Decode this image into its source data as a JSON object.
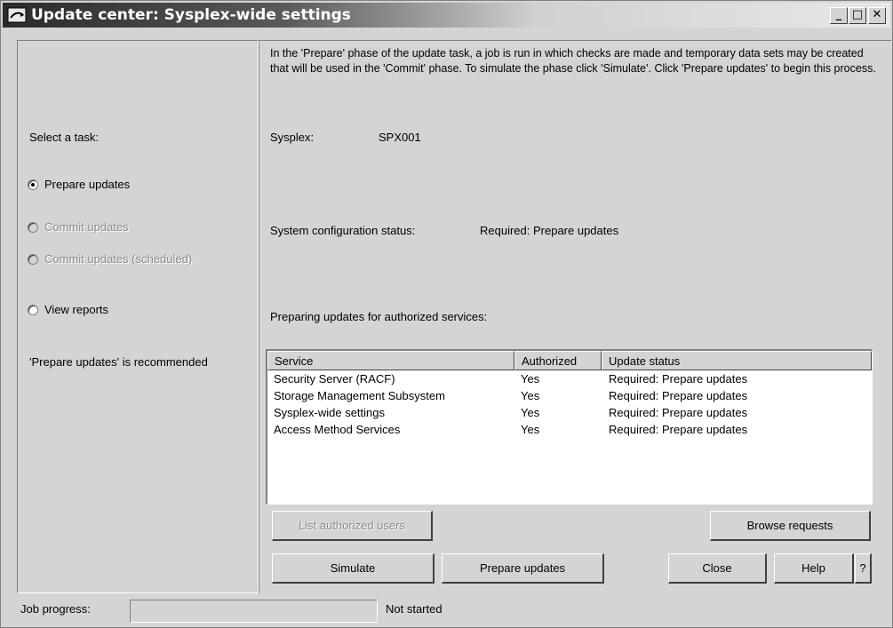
{
  "window": {
    "title": "Update center: Sysplex-wide settings",
    "controls": {
      "minimize": "_",
      "maximize": "□",
      "close": "✕"
    }
  },
  "left": {
    "select_task_label": "Select a task:",
    "tasks": [
      {
        "label": "Prepare updates",
        "checked": true,
        "enabled": true
      },
      {
        "label": "Commit updates",
        "checked": false,
        "enabled": false
      },
      {
        "label": "Commit updates (scheduled)",
        "checked": false,
        "enabled": false
      },
      {
        "label": "View reports",
        "checked": false,
        "enabled": true
      }
    ],
    "recommendation": "'Prepare updates' is recommended"
  },
  "main": {
    "intro_text": "In the 'Prepare' phase of the update task, a job is run in which checks are made and temporary data sets may be created that will be used in the 'Commit' phase. To simulate the phase click 'Simulate'. Click 'Prepare updates' to begin this process.",
    "sysplex_label": "Sysplex:",
    "sysplex_value": "SPX001",
    "config_status_label": "System configuration status:",
    "config_status_value": "Required: Prepare updates",
    "services_heading": "Preparing updates for authorized services:",
    "table": {
      "columns": [
        "Service",
        "Authorized",
        "Update status"
      ],
      "rows": [
        [
          "Security Server (RACF)",
          "Yes",
          "Required: Prepare updates"
        ],
        [
          "Storage Management Subsystem",
          "Yes",
          "Required: Prepare updates"
        ],
        [
          "Sysplex-wide settings",
          "Yes",
          "Required: Prepare updates"
        ],
        [
          "Access Method Services",
          "Yes",
          "Required: Prepare updates"
        ]
      ]
    },
    "buttons": {
      "list_authorized_users": "List authorized users",
      "browse_requests": "Browse requests",
      "simulate": "Simulate",
      "prepare_updates": "Prepare updates",
      "close": "Close",
      "help": "Help",
      "question": "?"
    }
  },
  "footer": {
    "job_progress_label": "Job progress:",
    "progress_fraction": 0,
    "job_status": "Not started"
  },
  "colors": {
    "window_bg": "#d4d4d4",
    "disabled_text": "#8c8c8c",
    "title_gradient_start": "#2a2a2a"
  }
}
